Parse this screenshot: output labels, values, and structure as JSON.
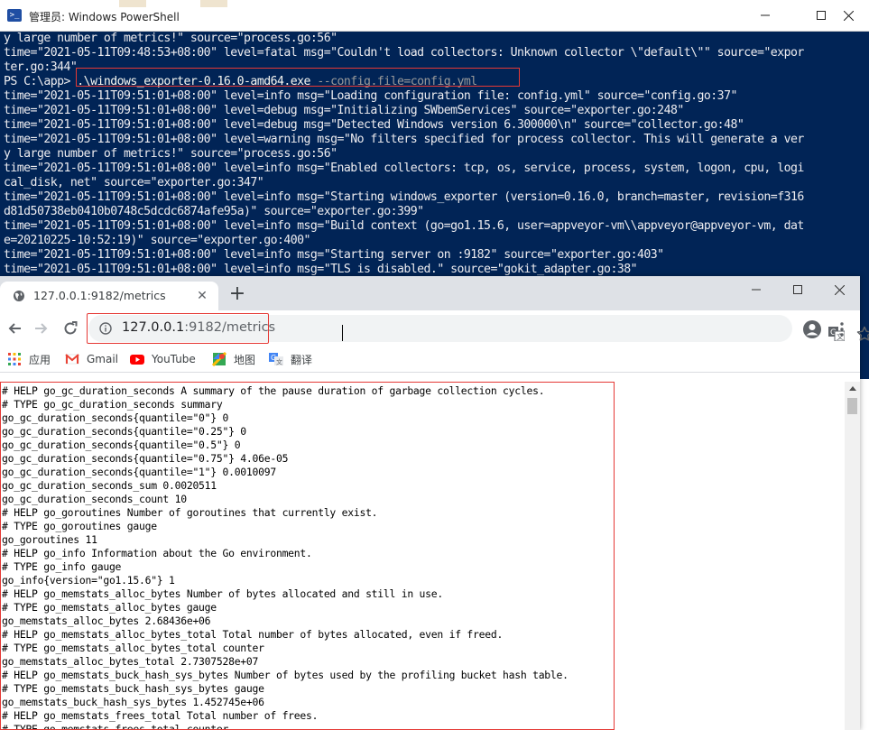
{
  "powershell": {
    "title": "管理员: Windows PowerShell",
    "icon": "powershell-icon",
    "lines": [
      "y large number of metrics!\" source=\"process.go:56\"",
      "time=\"2021-05-11T09:48:53+08:00\" level=fatal msg=\"Couldn't load collectors: Unknown collector \\\"default\\\"\" source=\"expor",
      "ter.go:344\"",
      "",
      "time=\"2021-05-11T09:51:01+08:00\" level=info msg=\"Loading configuration file: config.yml\" source=\"config.go:37\"",
      "time=\"2021-05-11T09:51:01+08:00\" level=debug msg=\"Initializing SWbemServices\" source=\"exporter.go:248\"",
      "time=\"2021-05-11T09:51:01+08:00\" level=debug msg=\"Detected Windows version 6.300000\\n\" source=\"collector.go:48\"",
      "time=\"2021-05-11T09:51:01+08:00\" level=warning msg=\"No filters specified for process collector. This will generate a ver",
      "y large number of metrics!\" source=\"process.go:56\"",
      "time=\"2021-05-11T09:51:01+08:00\" level=info msg=\"Enabled collectors: tcp, os, service, process, system, logon, cpu, logi",
      "cal_disk, net\" source=\"exporter.go:347\"",
      "time=\"2021-05-11T09:51:01+08:00\" level=info msg=\"Starting windows_exporter (version=0.16.0, branch=master, revision=f316",
      "d81d50738eb0410b0748c5dcdc6874afe95a)\" source=\"exporter.go:399\"",
      "time=\"2021-05-11T09:51:01+08:00\" level=info msg=\"Build context (go=go1.15.6, user=appveyor-vm\\\\appveyor@appveyor-vm, dat",
      "e=20210225-10:52:19)\" source=\"exporter.go:400\"",
      "time=\"2021-05-11T09:51:01+08:00\" level=info msg=\"Starting server on :9182\" source=\"exporter.go:403\"",
      "time=\"2021-05-11T09:51:01+08:00\" level=info msg=\"TLS is disabled.\" source=\"gokit_adapter.go:38\""
    ],
    "prompt": "PS C:\\app> ",
    "command": ".\\windows_exporter-0.16.0-amd64.exe",
    "command_args": " --config.file=config.yml"
  },
  "browser": {
    "tab_title": "127.0.0.1:9182/metrics",
    "url_host": "127.0.0.1",
    "url_path": ":9182/metrics",
    "bookmarks": [
      {
        "label": "应用",
        "icon": "apps-grid-icon"
      },
      {
        "label": "Gmail",
        "icon": "gmail-icon"
      },
      {
        "label": "YouTube",
        "icon": "youtube-icon"
      },
      {
        "label": "地图",
        "icon": "maps-icon"
      },
      {
        "label": "翻译",
        "icon": "translate-icon"
      }
    ],
    "metrics_lines": [
      "# HELP go_gc_duration_seconds A summary of the pause duration of garbage collection cycles.",
      "# TYPE go_gc_duration_seconds summary",
      "go_gc_duration_seconds{quantile=\"0\"} 0",
      "go_gc_duration_seconds{quantile=\"0.25\"} 0",
      "go_gc_duration_seconds{quantile=\"0.5\"} 0",
      "go_gc_duration_seconds{quantile=\"0.75\"} 4.06e-05",
      "go_gc_duration_seconds{quantile=\"1\"} 0.0010097",
      "go_gc_duration_seconds_sum 0.0020511",
      "go_gc_duration_seconds_count 10",
      "# HELP go_goroutines Number of goroutines that currently exist.",
      "# TYPE go_goroutines gauge",
      "go_goroutines 11",
      "# HELP go_info Information about the Go environment.",
      "# TYPE go_info gauge",
      "go_info{version=\"go1.15.6\"} 1",
      "# HELP go_memstats_alloc_bytes Number of bytes allocated and still in use.",
      "# TYPE go_memstats_alloc_bytes gauge",
      "go_memstats_alloc_bytes 2.68436e+06",
      "# HELP go_memstats_alloc_bytes_total Total number of bytes allocated, even if freed.",
      "# TYPE go_memstats_alloc_bytes_total counter",
      "go_memstats_alloc_bytes_total 2.7307528e+07",
      "# HELP go_memstats_buck_hash_sys_bytes Number of bytes used by the profiling bucket hash table.",
      "# TYPE go_memstats_buck_hash_sys_bytes gauge",
      "go_memstats_buck_hash_sys_bytes 1.452745e+06",
      "# HELP go_memstats_frees_total Total number of frees.",
      "# TYPE go_memstats_frees_total counter"
    ]
  },
  "colors": {
    "powershell_bg": "#012456",
    "highlight_red": "#e53935"
  }
}
